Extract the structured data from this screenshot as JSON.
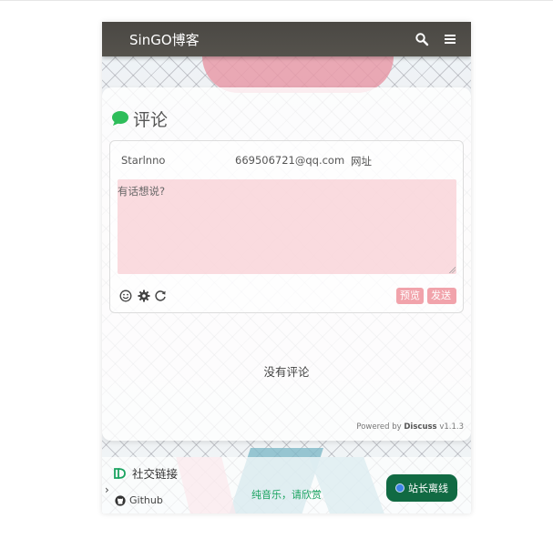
{
  "header": {
    "site_title": "SinGO博客",
    "icons": [
      "search-icon",
      "menu-icon"
    ]
  },
  "comments": {
    "title": "评论",
    "title_icon": "chat-bubble-icon",
    "name_value": "Starlnno",
    "email_value": "669506721@qq.com",
    "website_placeholder": "网址",
    "textarea_placeholder": "有话想说?",
    "tools": [
      "emoji-icon",
      "gear-icon",
      "refresh-icon"
    ],
    "preview_label": "预览",
    "send_label": "发送",
    "empty_text": "没有评论",
    "powered_by": "Powered by",
    "brand": "Discuss",
    "version": "v1.1.3"
  },
  "social": {
    "title": "社交链接",
    "github_label": "Github",
    "music_text": "纯音乐，请欣赏",
    "admin_button_label": "站长离线"
  },
  "colors": {
    "header_bg": "#4a4844",
    "accent_green": "#1aa360",
    "button_pink": "#f1a3ab",
    "admin_green": "#116a43"
  }
}
